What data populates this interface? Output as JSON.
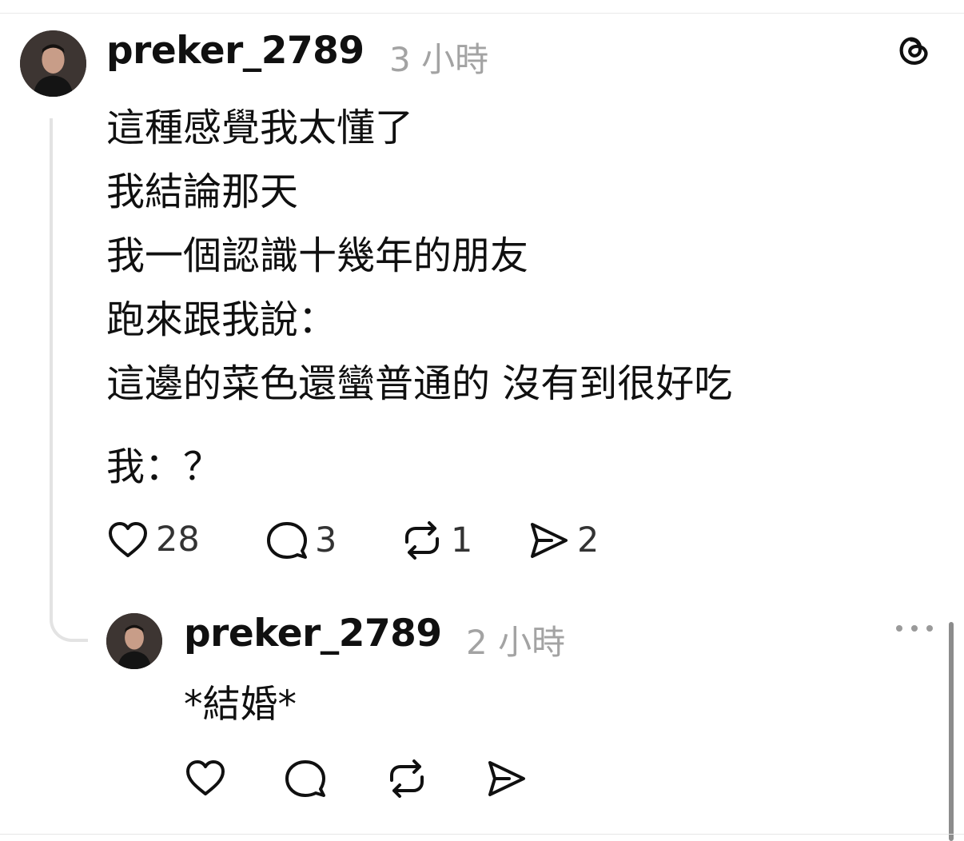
{
  "post": {
    "username": "preker_2789",
    "timestamp": "3 小時",
    "lines": [
      "這種感覺我太懂了",
      "我結論那天",
      "我一個認識十幾年的朋友",
      "跑來跟我說：",
      "這邊的菜色還蠻普通的 沒有到很好吃"
    ],
    "after_gap_line": "我：？",
    "likes": "28",
    "replies": "3",
    "reposts": "1",
    "shares": "2"
  },
  "reply": {
    "username": "preker_2789",
    "timestamp": "2 小時",
    "text": "*結婚*"
  },
  "icons": {
    "header_logo": "threads-logo-icon",
    "menu": "more-options-icon",
    "like": "heart-icon",
    "comment": "comment-bubble-icon",
    "repost": "repost-icon",
    "share": "send-icon"
  },
  "colors": {
    "text": "#101010",
    "muted": "#a3a3a3",
    "thread_line": "#e3e3e3"
  }
}
